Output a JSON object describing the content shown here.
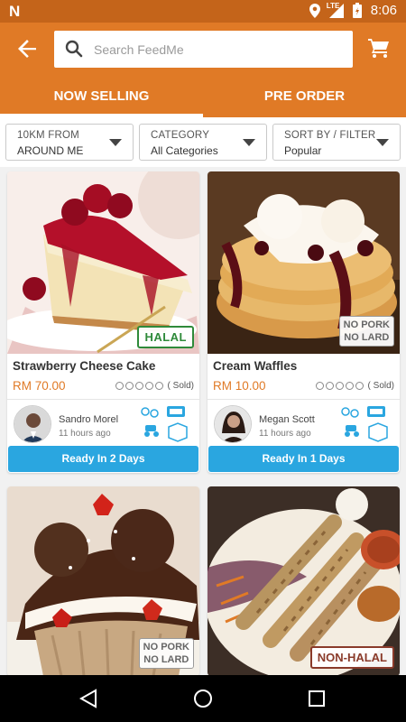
{
  "status": {
    "app_icon": "N",
    "network": "LTE",
    "time": "8:06",
    "icons": [
      "location-icon",
      "signal-icon",
      "battery-icon"
    ]
  },
  "header": {
    "search_placeholder": "Search FeedMe",
    "tabs": [
      {
        "label": "NOW SELLING",
        "active": true
      },
      {
        "label": "PRE ORDER",
        "active": false
      }
    ]
  },
  "filters": [
    {
      "key": "10KM FROM",
      "value": "AROUND ME"
    },
    {
      "key": "CATEGORY",
      "value": "All Categories"
    },
    {
      "key": "SORT BY / FILTER",
      "value": "Popular"
    }
  ],
  "products": [
    {
      "title": "Strawberry Cheese Cake",
      "price": "RM 70.00",
      "sold": "( Sold)",
      "badge": "HALAL",
      "seller": "Sandro Morel",
      "time": "11 hours ago",
      "ready": "Ready In 2 Days"
    },
    {
      "title": "Cream Waffles",
      "price": "RM 10.00",
      "sold": "( Sold)",
      "badge_line1": "NO PORK",
      "badge_line2": "NO LARD",
      "seller": "Megan Scott",
      "time": "11 hours ago",
      "ready": "Ready In 1 Days"
    },
    {
      "badge_line1": "NO PORK",
      "badge_line2": "NO LARD"
    },
    {
      "badge": "NON-HALAL"
    }
  ],
  "colors": {
    "primary": "#e07a26",
    "status_bar": "#c4641a",
    "accent_blue": "#2aa6e0",
    "halal_green": "#2f8a3a"
  }
}
